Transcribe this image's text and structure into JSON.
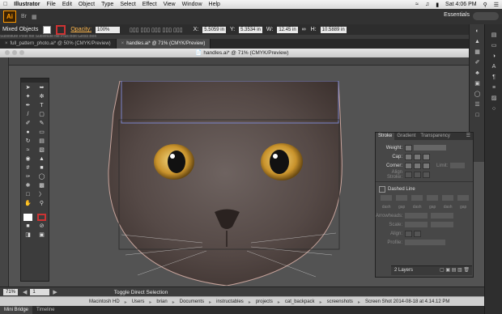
{
  "menubar": {
    "apple": "",
    "app": "Illustrator",
    "items": [
      "File",
      "Edit",
      "Object",
      "Type",
      "Select",
      "Effect",
      "View",
      "Window",
      "Help"
    ],
    "clock": "Sat 4:06 PM"
  },
  "appbar": {
    "logo": "Ai",
    "workspace": "Essentials"
  },
  "control": {
    "selection": "Mixed Objects",
    "opacity_label": "Opacity:",
    "opacity": "100%",
    "x": "5.5059 in",
    "y": "5.3534 in",
    "w": "12.45 in",
    "h": "10.5889 in"
  },
  "ghost_text": "Substitute     Pixel file     Substitute file     Plus Bolt     Gloss Bolt",
  "tabs": [
    {
      "label": "full_pattern_photo.ai* @ 50% (CMYK/Preview)",
      "active": false
    },
    {
      "label": "handles.ai* @ 71% (CMYK/Preview)",
      "active": true
    }
  ],
  "doc_title": "handles.ai* @ 71% (CMYK/Preview)",
  "stroke_panel": {
    "tabs": [
      "Stroke",
      "Gradient",
      "Transparency"
    ],
    "weight_label": "Weight:",
    "cap_label": "Cap:",
    "corner_label": "Corner:",
    "limit_label": "Limit:",
    "align_label": "Align Stroke:",
    "dashed_label": "Dashed Line",
    "dash_labels": [
      "dash",
      "gap",
      "dash",
      "gap",
      "dash",
      "gap"
    ],
    "arrowheads_label": "Arrowheads:",
    "scale_label": "Scale:",
    "align2_label": "Align:",
    "profile_label": "Profile:"
  },
  "layers_bar": "2 Layers",
  "status": {
    "zoom": "71%",
    "page": "1",
    "message": "Toggle Direct Selection"
  },
  "finder_path": [
    "Macintosh HD",
    "Users",
    "brian",
    "Documents",
    "instructables",
    "projects",
    "cat_backpack",
    "screenshots",
    "Screen Shot 2014-08-18 at 4.14.12 PM"
  ],
  "bottom_tabs": [
    "Mini Bridge",
    "Timeline"
  ]
}
